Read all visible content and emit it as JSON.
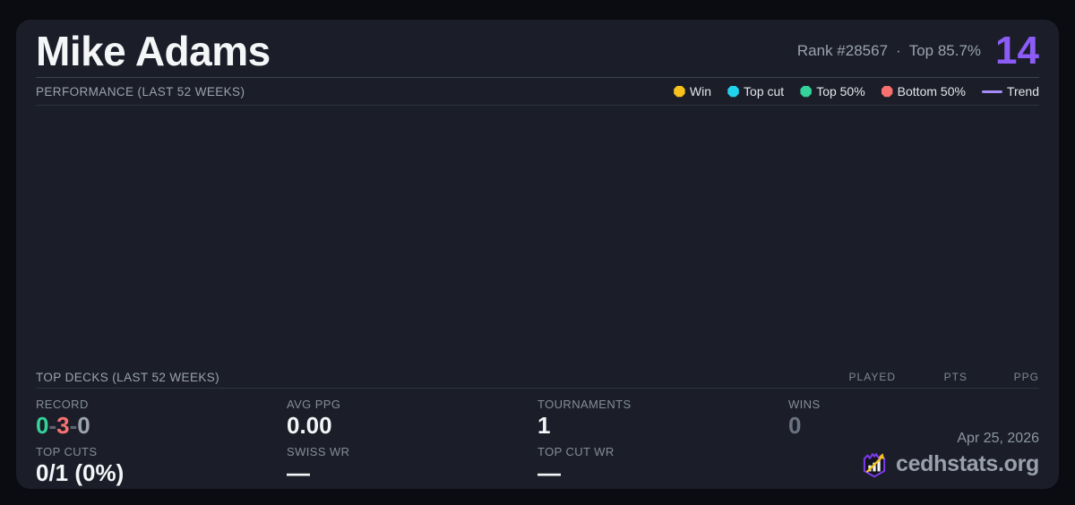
{
  "player": {
    "name": "Mike Adams",
    "rank": "Rank #28567",
    "separator": "·",
    "top_percent": "Top 85.7%",
    "score": "14",
    "score_color": "#8b5cf6"
  },
  "performance": {
    "title": "PERFORMANCE (LAST 52 WEEKS)",
    "legend": [
      {
        "label": "Win",
        "color": "#f6c21b",
        "type": "dot"
      },
      {
        "label": "Top cut",
        "color": "#22d3ee",
        "type": "dot"
      },
      {
        "label": "Top 50%",
        "color": "#34d399",
        "type": "dot"
      },
      {
        "label": "Bottom 50%",
        "color": "#f87171",
        "type": "dot"
      },
      {
        "label": "Trend",
        "color": "#a78bfa",
        "type": "line"
      }
    ],
    "chart_empty": true
  },
  "top_decks": {
    "title": "TOP DECKS (LAST 52 WEEKS)",
    "columns": [
      "PLAYED",
      "PTS",
      "PPG"
    ],
    "rows": []
  },
  "stats": {
    "record": {
      "label": "RECORD",
      "wins": "0",
      "losses": "3",
      "draws": "0",
      "sep": "-",
      "wins_color": "#34d399",
      "losses_color": "#f87171",
      "draws_color": "#9ca3af"
    },
    "avg_ppg": {
      "label": "AVG PPG",
      "value": "0.00"
    },
    "tournaments": {
      "label": "TOURNAMENTS",
      "value": "1"
    },
    "wins": {
      "label": "WINS",
      "value": "0"
    },
    "top_cuts": {
      "label": "TOP CUTS",
      "value": "0/1 (0%)"
    },
    "swiss_wr": {
      "label": "SWISS WR",
      "value": "—"
    },
    "top_cut_wr": {
      "label": "TOP CUT WR",
      "value": "—"
    }
  },
  "footer": {
    "date": "Apr 25, 2026",
    "brand": "cedhstats.org"
  },
  "colors": {
    "page_bg": "#0b0c11",
    "card_bg": "#1b1e28",
    "divider": "#2e3342",
    "accent_purple": "#8b5cf6",
    "brand_purple": "#7c3aed",
    "brand_gold": "#f6c21b"
  }
}
